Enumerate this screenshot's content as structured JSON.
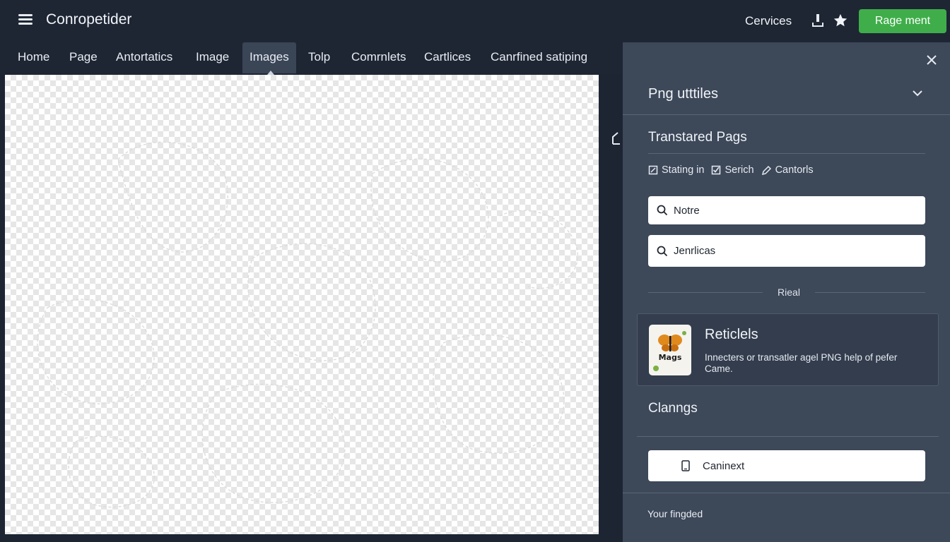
{
  "header": {
    "app_title": "Conropetider",
    "services_label": "Cervices",
    "primary_button_label": "Rage ment"
  },
  "nav": {
    "items": [
      {
        "label": "Home"
      },
      {
        "label": "Page"
      },
      {
        "label": "Antortatics"
      },
      {
        "label": "Image"
      },
      {
        "label": "Images"
      },
      {
        "label": "Tolp"
      },
      {
        "label": "Comrnlets"
      },
      {
        "label": "Cartlices"
      },
      {
        "label": "Canrfined satiping"
      }
    ],
    "active": "Images"
  },
  "panel": {
    "header_title": "Png utttiles",
    "section_title": "Transtared Pags",
    "tools": [
      {
        "label": "Stating in",
        "icon": "edit-icon"
      },
      {
        "label": "Serich",
        "icon": "checkbox-icon"
      },
      {
        "label": "Cantorls",
        "icon": "pen-icon"
      }
    ],
    "search_1_value": "Notre",
    "search_2_value": "Jenrlicas",
    "divider_label": "Rieal",
    "card": {
      "title": "Reticlels",
      "description": "Innecters or transatler agel PNG help of pefer Came.",
      "thumb_label": "Mags"
    },
    "section_title_2": "Clanngs",
    "connect_label": "Caninext",
    "footer_label": "Your fingded"
  },
  "colors": {
    "accent_green": "#3fae4a",
    "panel_bg": "#3d4859",
    "topbar_bg": "#1e2634"
  }
}
